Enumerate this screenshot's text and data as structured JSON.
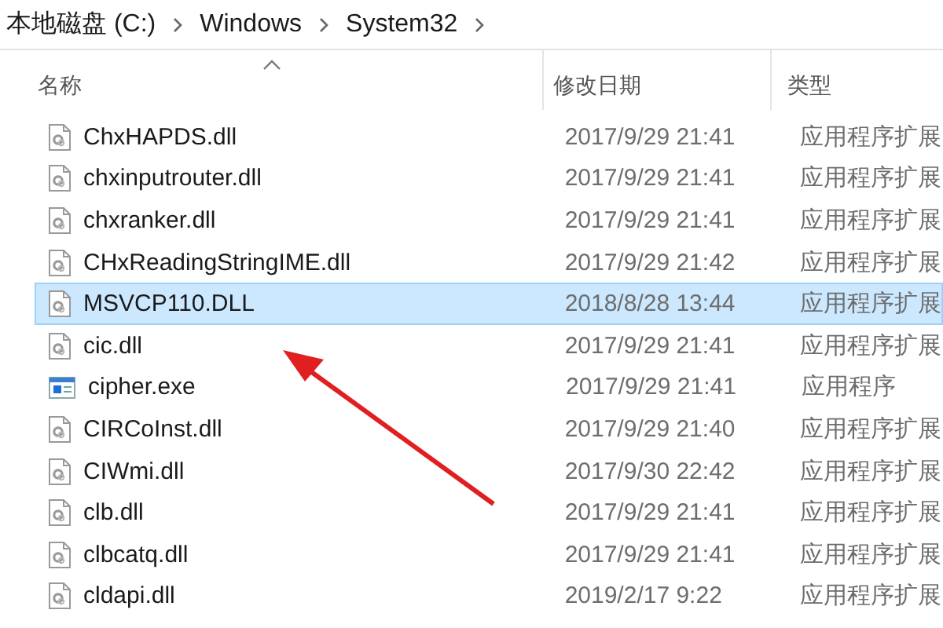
{
  "breadcrumb": [
    "本地磁盘 (C:)",
    "Windows",
    "System32"
  ],
  "columns": [
    {
      "label": "名称",
      "sorted": true
    },
    {
      "label": "修改日期",
      "sorted": false
    },
    {
      "label": "类型",
      "sorted": false
    }
  ],
  "rows": [
    {
      "name": "ChxHAPDS.dll",
      "date": "2017/9/29 21:41",
      "type": "应用程序扩展",
      "kind": "dll",
      "selected": false
    },
    {
      "name": "chxinputrouter.dll",
      "date": "2017/9/29 21:41",
      "type": "应用程序扩展",
      "kind": "dll",
      "selected": false
    },
    {
      "name": "chxranker.dll",
      "date": "2017/9/29 21:41",
      "type": "应用程序扩展",
      "kind": "dll",
      "selected": false
    },
    {
      "name": "CHxReadingStringIME.dll",
      "date": "2017/9/29 21:42",
      "type": "应用程序扩展",
      "kind": "dll",
      "selected": false
    },
    {
      "name": "MSVCP110.DLL",
      "date": "2018/8/28 13:44",
      "type": "应用程序扩展",
      "kind": "dll",
      "selected": true
    },
    {
      "name": "cic.dll",
      "date": "2017/9/29 21:41",
      "type": "应用程序扩展",
      "kind": "dll",
      "selected": false
    },
    {
      "name": "cipher.exe",
      "date": "2017/9/29 21:41",
      "type": "应用程序",
      "kind": "exe",
      "selected": false
    },
    {
      "name": "CIRCoInst.dll",
      "date": "2017/9/29 21:40",
      "type": "应用程序扩展",
      "kind": "dll",
      "selected": false
    },
    {
      "name": "CIWmi.dll",
      "date": "2017/9/30 22:42",
      "type": "应用程序扩展",
      "kind": "dll",
      "selected": false
    },
    {
      "name": "clb.dll",
      "date": "2017/9/29 21:41",
      "type": "应用程序扩展",
      "kind": "dll",
      "selected": false
    },
    {
      "name": "clbcatq.dll",
      "date": "2017/9/29 21:41",
      "type": "应用程序扩展",
      "kind": "dll",
      "selected": false
    },
    {
      "name": "cldapi.dll",
      "date": "2019/2/17 9:22",
      "type": "应用程序扩展",
      "kind": "dll",
      "selected": false
    }
  ],
  "annotation": {
    "kind": "arrow",
    "color": "#e02020"
  }
}
